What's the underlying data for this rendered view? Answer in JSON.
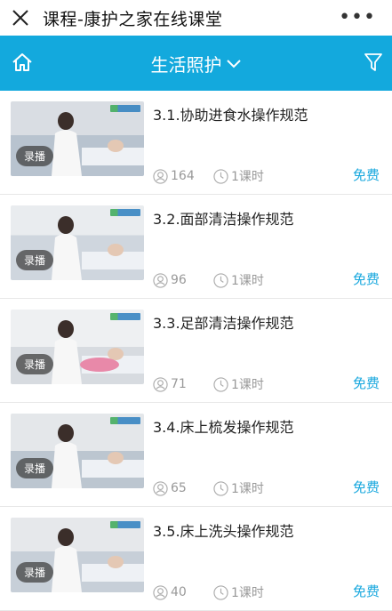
{
  "topbar": {
    "title": "课程-康护之家在线课堂",
    "more": "•••"
  },
  "navbar": {
    "category": "生活照护"
  },
  "courses": [
    {
      "title": "3.1.协助进食水操作规范",
      "badge": "录播",
      "views": "164",
      "hours": "1课时",
      "price": "免费",
      "scene": "a"
    },
    {
      "title": "3.2.面部清洁操作规范",
      "badge": "录播",
      "views": "96",
      "hours": "1课时",
      "price": "免费",
      "scene": "b"
    },
    {
      "title": "3.3.足部清洁操作规范",
      "badge": "录播",
      "views": "71",
      "hours": "1课时",
      "price": "免费",
      "scene": "c"
    },
    {
      "title": "3.4.床上梳发操作规范",
      "badge": "录播",
      "views": "65",
      "hours": "1课时",
      "price": "免费",
      "scene": "d"
    },
    {
      "title": "3.5.床上洗头操作规范",
      "badge": "录播",
      "views": "40",
      "hours": "1课时",
      "price": "免费",
      "scene": "e"
    }
  ],
  "colors": {
    "accent": "#13a9dd",
    "price": "#19a8de"
  },
  "icons": {
    "close": "close-icon",
    "more": "more-icon",
    "home": "home-icon",
    "filter": "filter-icon",
    "chevron": "chevron-down-icon",
    "user": "user-icon",
    "clock": "clock-icon"
  }
}
